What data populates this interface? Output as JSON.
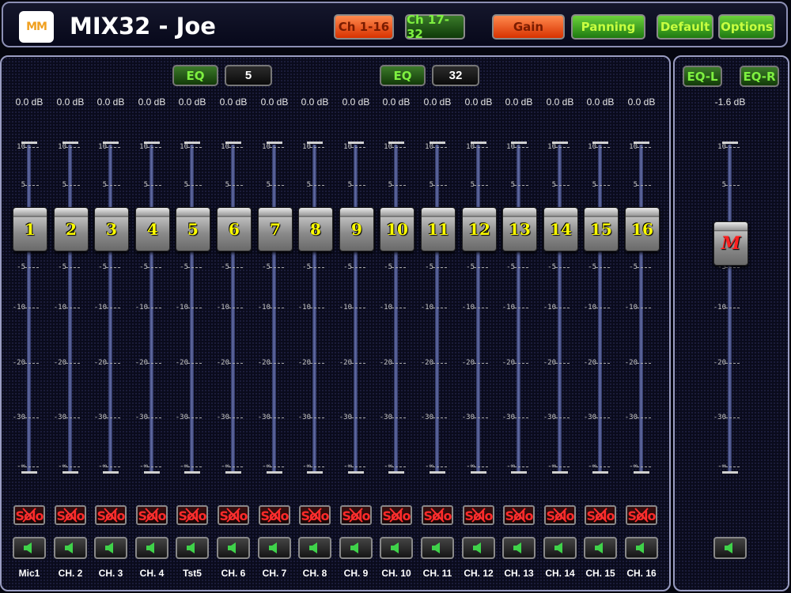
{
  "header": {
    "title": "MIX32 - Joe",
    "logo_text": "MM",
    "buttons": [
      {
        "label": "Ch 1-16",
        "style": "red"
      },
      {
        "label": "Ch 17-32",
        "style": "green"
      },
      {
        "label": "Gain",
        "style": "red"
      },
      {
        "label": "Panning",
        "style": "green"
      },
      {
        "label": "Default",
        "style": "green"
      },
      {
        "label": "Options",
        "style": "green"
      }
    ]
  },
  "main": {
    "eq_left": {
      "label": "EQ",
      "value": "5"
    },
    "eq_right": {
      "label": "EQ",
      "value": "32"
    },
    "scale_labels": [
      "10",
      "5",
      "0",
      "-5",
      "-10",
      "-20",
      "-30",
      "-∞"
    ],
    "solo_label": "Solo",
    "channels": [
      {
        "number": "1",
        "db": "0.0 dB",
        "name": "Mic1"
      },
      {
        "number": "2",
        "db": "0.0 dB",
        "name": "CH. 2"
      },
      {
        "number": "3",
        "db": "0.0 dB",
        "name": "CH. 3"
      },
      {
        "number": "4",
        "db": "0.0 dB",
        "name": "CH. 4"
      },
      {
        "number": "5",
        "db": "0.0 dB",
        "name": "Tst5"
      },
      {
        "number": "6",
        "db": "0.0 dB",
        "name": "CH. 6"
      },
      {
        "number": "7",
        "db": "0.0 dB",
        "name": "CH. 7"
      },
      {
        "number": "8",
        "db": "0.0 dB",
        "name": "CH. 8"
      },
      {
        "number": "9",
        "db": "0.0 dB",
        "name": "CH. 9"
      },
      {
        "number": "10",
        "db": "0.0 dB",
        "name": "CH. 10"
      },
      {
        "number": "11",
        "db": "0.0 dB",
        "name": "CH. 11"
      },
      {
        "number": "12",
        "db": "0.0 dB",
        "name": "CH. 12"
      },
      {
        "number": "13",
        "db": "0.0 dB",
        "name": "CH. 13"
      },
      {
        "number": "14",
        "db": "0.0 dB",
        "name": "CH. 14"
      },
      {
        "number": "15",
        "db": "0.0 dB",
        "name": "CH. 15"
      },
      {
        "number": "16",
        "db": "0.0 dB",
        "name": "CH. 16"
      }
    ]
  },
  "master": {
    "eq_l": "EQ-L",
    "eq_r": "EQ-R",
    "db": "-1.6 dB",
    "fader_label": "M"
  },
  "colors": {
    "accent_red": "#d83200",
    "accent_green": "#1e7a10",
    "fader_number": "#ffff00",
    "master_fader": "#ff2020"
  },
  "icons": {
    "mute": "speaker-icon",
    "solo_crossed": "cross-icon"
  }
}
